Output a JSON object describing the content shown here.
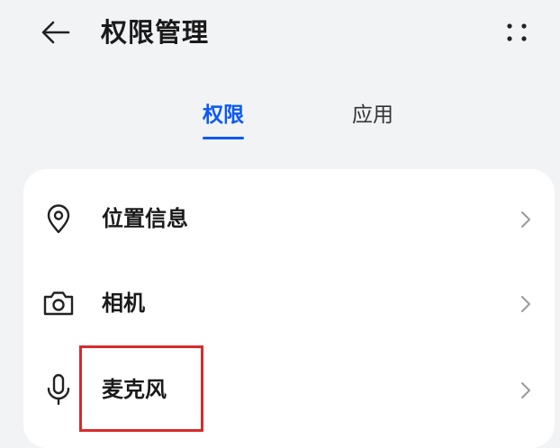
{
  "header": {
    "back_icon": "arrow-left-icon",
    "title": "权限管理",
    "more_icon": "more-dots-icon"
  },
  "tabs": [
    {
      "label": "权限",
      "active": true
    },
    {
      "label": "应用",
      "active": false
    }
  ],
  "permissions": [
    {
      "label": "位置信息",
      "icon": "location-pin-icon"
    },
    {
      "label": "相机",
      "icon": "camera-icon"
    },
    {
      "label": "麦克风",
      "icon": "microphone-icon"
    }
  ],
  "colors": {
    "accent": "#0a59f7",
    "highlight_box": "#d62b2b",
    "background": "#f1f3f5",
    "card": "#ffffff"
  }
}
